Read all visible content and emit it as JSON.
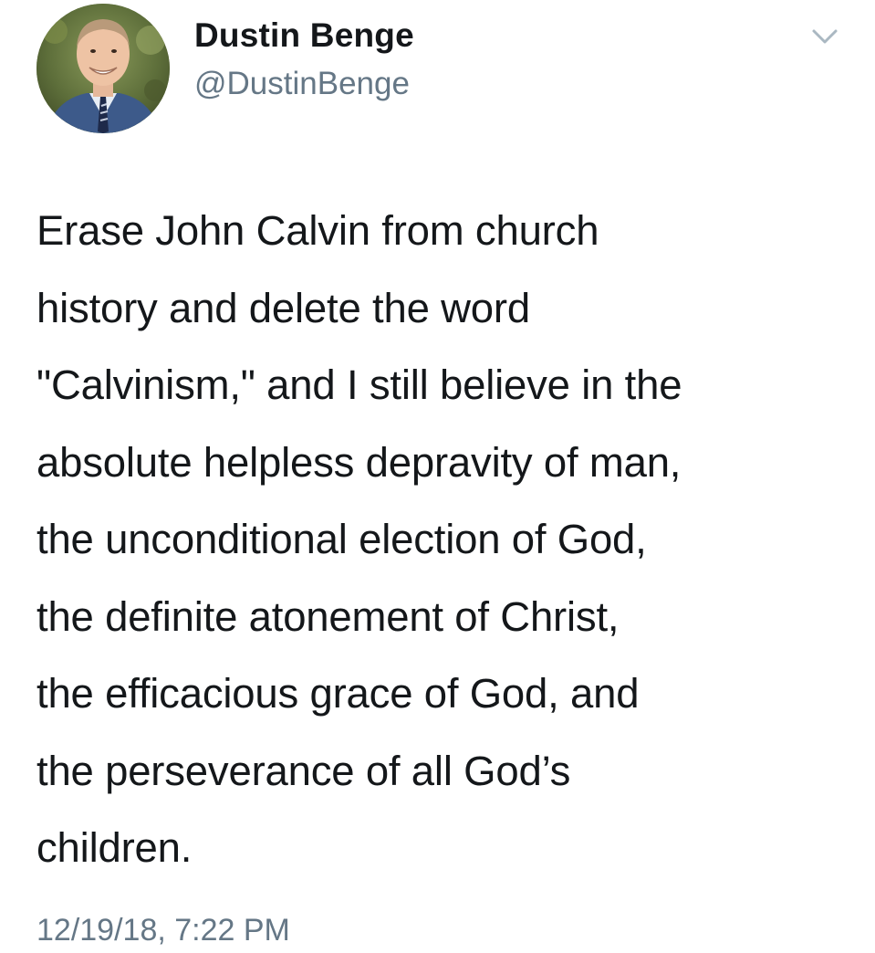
{
  "tweet": {
    "author": {
      "display_name": "Dustin Benge",
      "handle": "@DustinBenge",
      "avatar_icon": "profile-photo"
    },
    "menu_icon": "chevron-down-icon",
    "body_lines": [
      "Erase John Calvin from church",
      "history and delete the word",
      "\"Calvinism,\" and I still believe in the",
      "absolute helpless depravity of man,",
      "the unconditional election of God,",
      "the definite atonement of Christ,",
      "the efficacious grace of God, and",
      "the perseverance of all God’s",
      "children."
    ],
    "timestamp": "12/19/18, 7:22 PM"
  },
  "colors": {
    "text_primary": "#14171a",
    "text_secondary": "#657786",
    "background": "#ffffff"
  }
}
